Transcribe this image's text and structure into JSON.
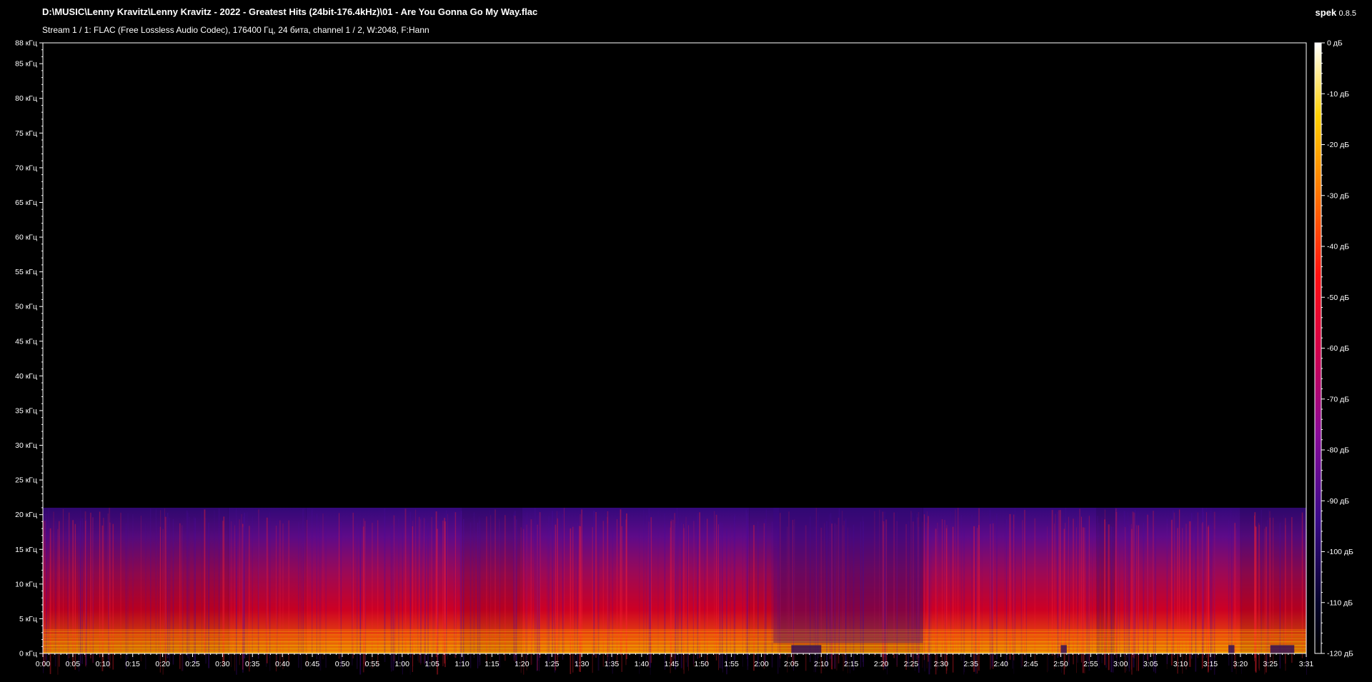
{
  "header": {
    "file_path": "D:\\MUSIC\\Lenny Kravitz\\Lenny Kravitz - 2022 - Greatest Hits (24bit-176.4kHz)\\01 - Are You Gonna Go My Way.flac",
    "stream_info": "Stream 1 / 1: FLAC (Free Lossless Audio Codec), 176400 Гц, 24 бита, channel 1 / 2, W:2048, F:Hann",
    "app_name": "spek",
    "app_version": "0.8.5"
  },
  "colors": {
    "background": "#000000",
    "axis": "#ffffff",
    "spectrum_low": "#3a0a8a",
    "spectrum_mid": "#e00030",
    "spectrum_high": "#ffa000"
  },
  "chart_data": {
    "type": "heatmap",
    "xlabel": "",
    "ylabel": "",
    "y_unit": "кГц",
    "x_ticks": [
      "0:00",
      "0:05",
      "0:10",
      "0:15",
      "0:20",
      "0:25",
      "0:30",
      "0:35",
      "0:40",
      "0:45",
      "0:50",
      "0:55",
      "1:00",
      "1:05",
      "1:10",
      "1:15",
      "1:20",
      "1:25",
      "1:30",
      "1:35",
      "1:40",
      "1:45",
      "1:50",
      "1:55",
      "2:00",
      "2:05",
      "2:10",
      "2:15",
      "2:20",
      "2:25",
      "2:30",
      "2:35",
      "2:40",
      "2:45",
      "2:50",
      "2:55",
      "3:00",
      "3:05",
      "3:10",
      "3:15",
      "3:20",
      "3:25",
      "3:31"
    ],
    "xlim": [
      0,
      211
    ],
    "y_ticks": [
      "0 кГц",
      "5 кГц",
      "10 кГц",
      "15 кГц",
      "20 кГц",
      "25 кГц",
      "30 кГц",
      "35 кГц",
      "40 кГц",
      "45 кГц",
      "50 кГц",
      "55 кГц",
      "60 кГц",
      "65 кГц",
      "70 кГц",
      "75 кГц",
      "80 кГц",
      "85 кГц",
      "88 кГц"
    ],
    "y_values": [
      0,
      5,
      10,
      15,
      20,
      25,
      30,
      35,
      40,
      45,
      50,
      55,
      60,
      65,
      70,
      75,
      80,
      85,
      88
    ],
    "ylim": [
      0,
      88
    ],
    "colorbar_ticks": [
      "0 дБ",
      "-10 дБ",
      "-20 дБ",
      "-30 дБ",
      "-40 дБ",
      "-50 дБ",
      "-60 дБ",
      "-70 дБ",
      "-80 дБ",
      "-90 дБ",
      "-100 дБ",
      "-110 дБ",
      "-120 дБ"
    ],
    "colorbar_values": [
      0,
      -10,
      -20,
      -30,
      -40,
      -50,
      -60,
      -70,
      -80,
      -90,
      -100,
      -110,
      -120
    ],
    "colorbar_range": [
      -120,
      0
    ],
    "spectrum_cutoff_khz": 21,
    "segments": [
      {
        "start": 0,
        "end": 31,
        "intensity": 0.55
      },
      {
        "start": 31,
        "end": 44,
        "intensity": 0.7
      },
      {
        "start": 44,
        "end": 70,
        "intensity": 0.75
      },
      {
        "start": 70,
        "end": 80,
        "intensity": 0.55
      },
      {
        "start": 80,
        "end": 118,
        "intensity": 0.75
      },
      {
        "start": 118,
        "end": 123,
        "intensity": 0.65
      },
      {
        "start": 123,
        "end": 147,
        "intensity": 0.45
      },
      {
        "start": 147,
        "end": 176,
        "intensity": 0.75
      },
      {
        "start": 176,
        "end": 179,
        "intensity": 0.5
      },
      {
        "start": 179,
        "end": 200,
        "intensity": 0.75
      },
      {
        "start": 200,
        "end": 211,
        "intensity": 0.5
      }
    ]
  }
}
